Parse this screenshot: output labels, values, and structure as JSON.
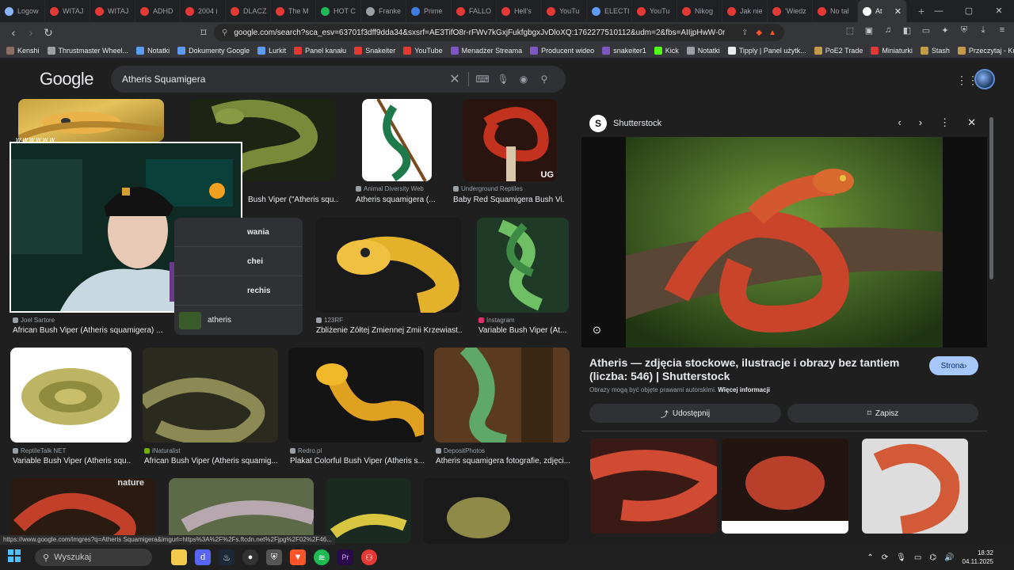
{
  "tabs": [
    {
      "label": "Logow",
      "color": "#8ab4f8"
    },
    {
      "label": "WITAJ",
      "color": "#e53935"
    },
    {
      "label": "WITAJ",
      "color": "#e53935"
    },
    {
      "label": "ADHD",
      "color": "#e53935"
    },
    {
      "label": "2004 i",
      "color": "#e53935"
    },
    {
      "label": "DLACZ",
      "color": "#e53935"
    },
    {
      "label": "The M",
      "color": "#e53935"
    },
    {
      "label": "HOT C",
      "color": "#1db954"
    },
    {
      "label": "Franke",
      "color": "#9aa0a6"
    },
    {
      "label": "Prime",
      "color": "#3d7de2"
    },
    {
      "label": "FALLO",
      "color": "#e53935"
    },
    {
      "label": "Hell's",
      "color": "#e53935"
    },
    {
      "label": "YouTu",
      "color": "#e53935"
    },
    {
      "label": "ELECTI",
      "color": "#5c9cf5"
    },
    {
      "label": "YouTu",
      "color": "#e53935"
    },
    {
      "label": "Nikog",
      "color": "#e53935"
    },
    {
      "label": "Jak nie",
      "color": "#e53935"
    },
    {
      "label": "'Wiedz",
      "color": "#e53935"
    },
    {
      "label": "No tal",
      "color": "#e53935"
    }
  ],
  "active_tab": {
    "label": "At",
    "close": "✕"
  },
  "new_tab": "+",
  "window_controls": {
    "minimize": "—",
    "maximize": "▢",
    "close": "✕"
  },
  "address": {
    "url": "google.com/search?sca_esv=63701f3dff9dda34&sxsrf=AE3TifO8r-rFWv7kGxjFukfgbgxJvDloXQ:1762277510112&udm=2&fbs=AIIjpHwW-0r_Aj4Ufv..."
  },
  "bookmarks": [
    {
      "label": "Kenshi",
      "color": "#8d6e63"
    },
    {
      "label": "Thrustmaster Wheel...",
      "color": "#9aa0a6"
    },
    {
      "label": "Notatki",
      "color": "#5c9cf5"
    },
    {
      "label": "Dokumenty Google",
      "color": "#5c9cf5"
    },
    {
      "label": "Lurkit",
      "color": "#5c9cf5"
    },
    {
      "label": "Panel kanału",
      "color": "#e53935"
    },
    {
      "label": "Snakeiter",
      "color": "#e53935"
    },
    {
      "label": "YouTube",
      "color": "#e53935"
    },
    {
      "label": "Menadżer Streama",
      "color": "#7e57c2"
    },
    {
      "label": "Producent wideo",
      "color": "#7e57c2"
    },
    {
      "label": "snakeiter1",
      "color": "#7e57c2"
    },
    {
      "label": "Kick",
      "color": "#53fc18"
    },
    {
      "label": "Notatki",
      "color": "#9aa0a6"
    },
    {
      "label": "Tipply | Panel użytk...",
      "color": "#e8eaed"
    },
    {
      "label": "PoE2 Trade",
      "color": "#c29a4a"
    },
    {
      "label": "Miniaturki",
      "color": "#e53935"
    },
    {
      "label": "Stash",
      "color": "#c29a4a"
    },
    {
      "label": "Przeczytaj - Kurs log...",
      "color": "#c29a4a"
    }
  ],
  "google": {
    "logo": "Google",
    "query": "Atheris Squamigera"
  },
  "webcam": {
    "label": "wwwwww"
  },
  "results": [
    {
      "source": "Animal Diversity Web",
      "caption": "Atheris squamigera (...",
      "src_color": "#9aa0a6"
    },
    {
      "source": "Underground Reptiles",
      "caption": "Baby Red Squamigera Bush Vi...",
      "src_color": "#9aa0a6"
    },
    {
      "source": "",
      "caption": "Bush Viper (\"Atheris squ...",
      "src_color": "#9aa0a6"
    },
    {
      "source": "Joel Sartore",
      "caption": "African Bush Viper (Atheris squamigera) ...",
      "src_color": "#9aa0a6"
    },
    {
      "source": "123RF",
      "caption": "Zbliżenie Żółtej Zmiennej Żmii Krzewiast...",
      "src_color": "#9aa0a6"
    },
    {
      "source": "Instagram",
      "caption": "Variable Bush Viper (At...",
      "src_color": "#e1306c"
    },
    {
      "source": "ReptileTalk NET",
      "caption": "Variable Bush Viper (Atheris squ...",
      "src_color": "#9aa0a6"
    },
    {
      "source": "iNaturalist",
      "caption": "African Bush Viper (Atheris squamig...",
      "src_color": "#74ac00"
    },
    {
      "source": "Redro.pl",
      "caption": "Plakat Colorful Bush Viper (Atheris s...",
      "src_color": "#9aa0a6"
    },
    {
      "source": "DepositPhotos",
      "caption": "Atheris squamigera fotografie, zdjęci...",
      "src_color": "#9aa0a6"
    }
  ],
  "related": [
    {
      "label": "wania"
    },
    {
      "label": "chei"
    },
    {
      "label": "rechis"
    },
    {
      "label": "atheris"
    }
  ],
  "badges": {
    "ug": "UG",
    "nature": "nature"
  },
  "panel": {
    "site": "Shutterstock",
    "site_logo": "S",
    "title": "Atheris — zdjęcia stockowe, ilustracje i obrazy bez tantiem (liczba: 546) | Shutterstock",
    "note": "Obrazy mogą być objęte prawami autorskimi.",
    "note_link": "Więcej informacji",
    "visit_label": "Strona",
    "share_label": "Udostępnij",
    "save_label": "Zapisz"
  },
  "status_url": "https://www.google.com/imgres?q=Atheris Squamigera&imgurl=https%3A%2F%2Fs.ftcdn.net%2Fjpg%2F02%2F46...",
  "taskbar": {
    "search_placeholder": "Wyszukaj",
    "time": "18:32",
    "date": "04.11.2025"
  }
}
